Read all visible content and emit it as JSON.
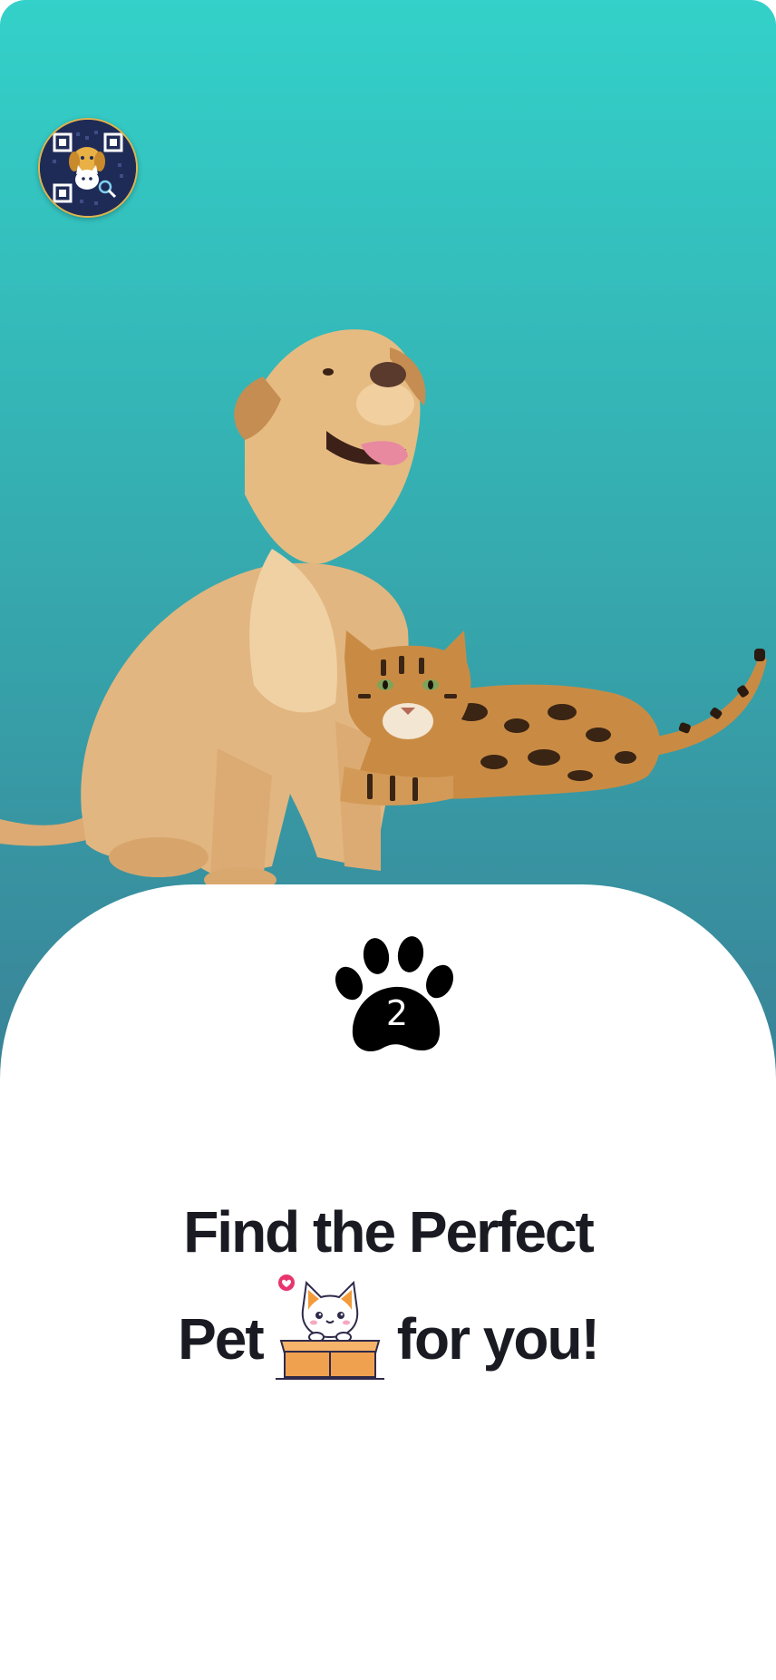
{
  "onboarding": {
    "step_number": "2",
    "headline_line1": "Find the Perfect",
    "headline_line2_start": "Pet",
    "headline_line2_end": "for you!"
  },
  "icons": {
    "app_logo": "app-logo-qr-dog-cat",
    "step_indicator": "paw-icon",
    "inline_emoji": "cat-in-box-icon"
  },
  "colors": {
    "gradient_top": "#33d1c9",
    "gradient_bottom": "#3a7f95",
    "headline": "#1a1b22",
    "paw": "#000000"
  }
}
